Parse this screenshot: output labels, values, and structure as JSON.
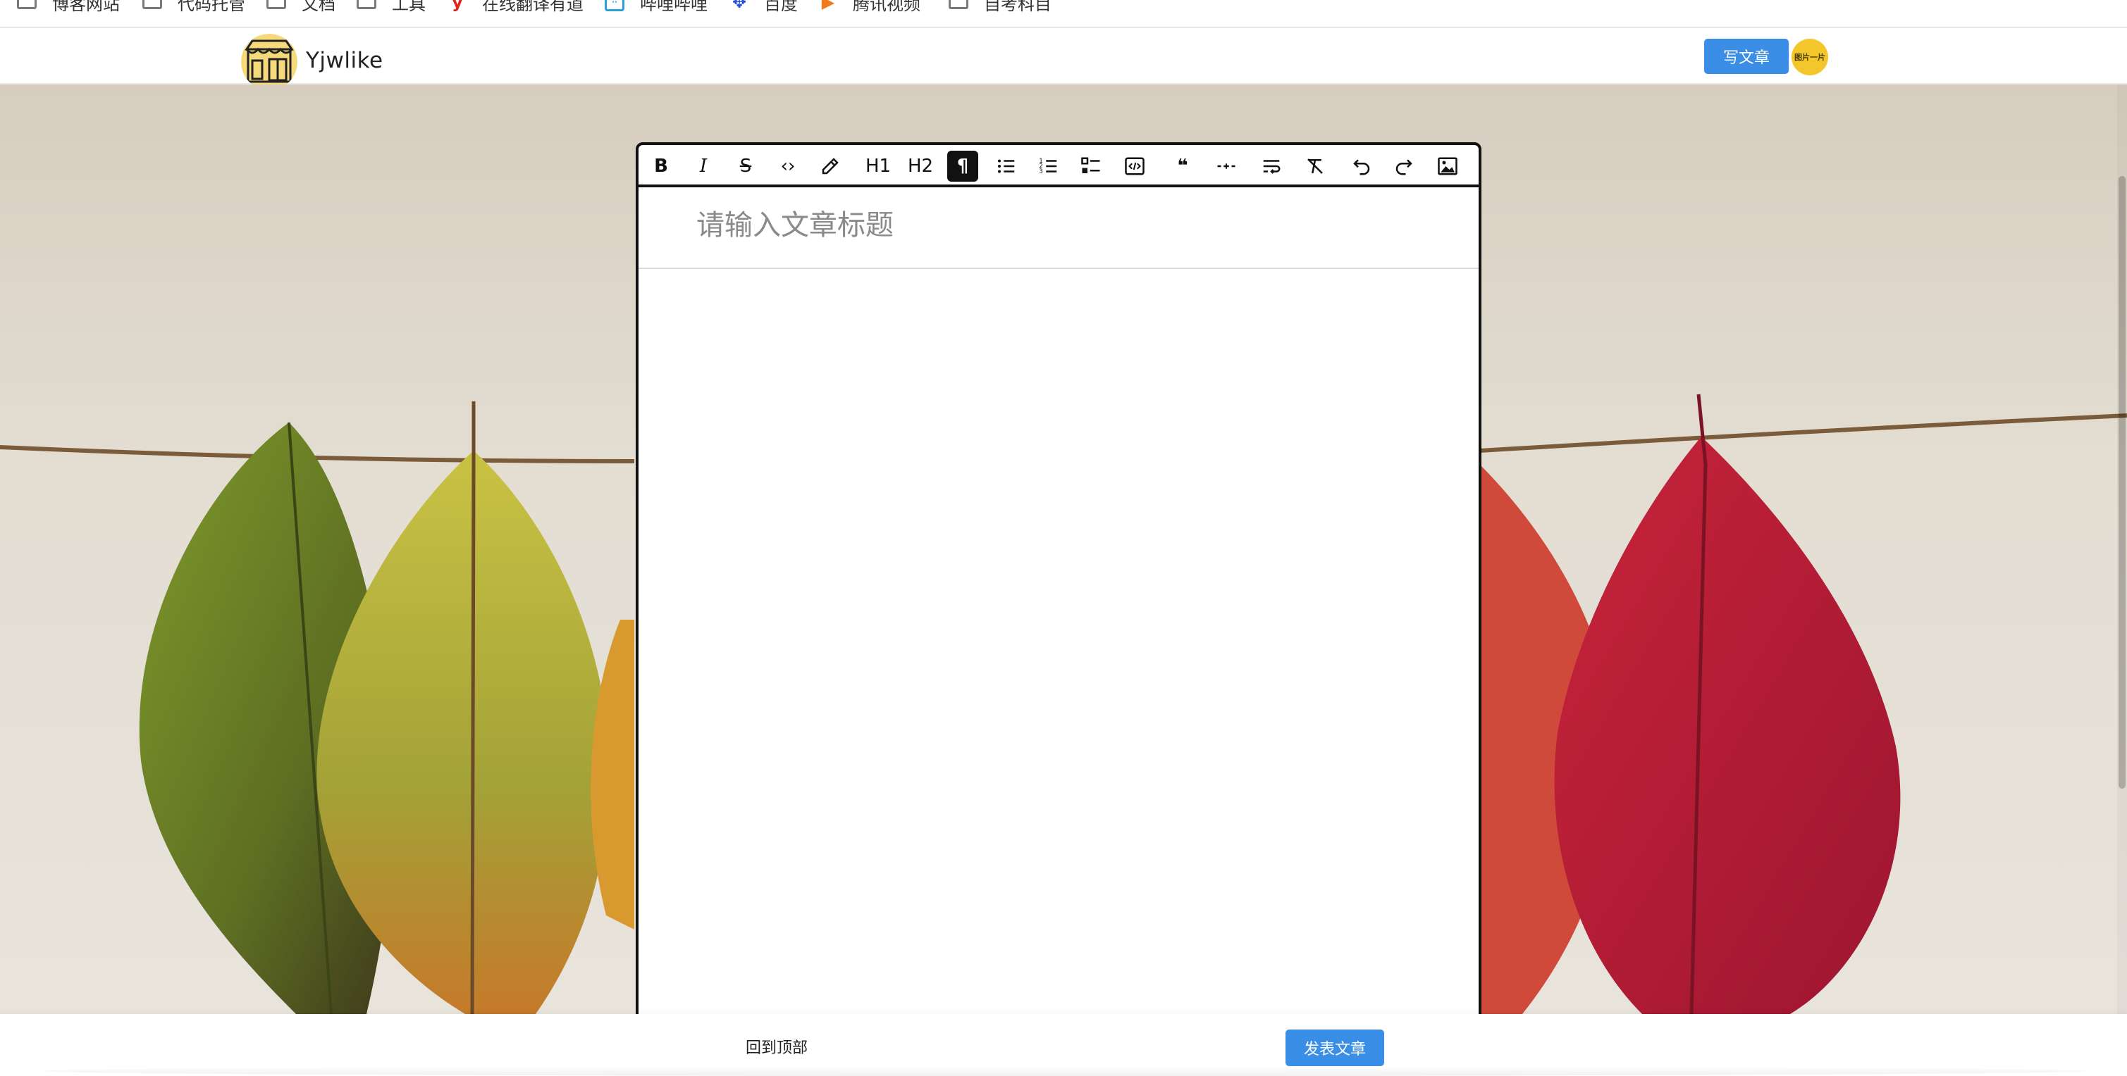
{
  "bookmarks": [
    {
      "label": "博客网站",
      "icon": "folder-icon"
    },
    {
      "label": "代码托管",
      "icon": "folder-icon"
    },
    {
      "label": "文档",
      "icon": "folder-icon"
    },
    {
      "label": "工具",
      "icon": "folder-icon"
    },
    {
      "label": "在线翻译有道",
      "icon": "youdao-icon"
    },
    {
      "label": "哔哩哔哩",
      "icon": "bilibili-icon"
    },
    {
      "label": "百度",
      "icon": "baidu-icon"
    },
    {
      "label": "腾讯视频",
      "icon": "tencent-video-icon"
    },
    {
      "label": "自考科目",
      "icon": "folder-icon"
    }
  ],
  "header": {
    "site_name": "Yjwlike",
    "write_button": "写文章",
    "avatar_text": "图片一片",
    "accent_color": "#3a8ee6"
  },
  "editor": {
    "title_placeholder": "请输入文章标题",
    "title_value": "",
    "toolbar": [
      {
        "name": "bold-button",
        "icon": "bold-icon",
        "text": "B"
      },
      {
        "name": "italic-button",
        "icon": "italic-icon",
        "text": "I"
      },
      {
        "name": "strikethrough-button",
        "icon": "strikethrough-icon",
        "text": "S"
      },
      {
        "name": "inline-code-button",
        "icon": "code-icon",
        "text": "‹›"
      },
      {
        "name": "highlight-button",
        "icon": "highlighter-icon",
        "text": ""
      },
      {
        "name": "heading1-button",
        "icon": "heading1-icon",
        "text": "H1"
      },
      {
        "name": "heading2-button",
        "icon": "heading2-icon",
        "text": "H2"
      },
      {
        "name": "paragraph-button",
        "icon": "paragraph-icon",
        "text": "¶",
        "active": true
      },
      {
        "name": "bullet-list-button",
        "icon": "bullet-list-icon",
        "text": ""
      },
      {
        "name": "ordered-list-button",
        "icon": "ordered-list-icon",
        "text": ""
      },
      {
        "name": "task-list-button",
        "icon": "task-list-icon",
        "text": ""
      },
      {
        "name": "code-block-button",
        "icon": "code-block-icon",
        "text": ""
      },
      {
        "name": "blockquote-button",
        "icon": "quote-icon",
        "text": "❝"
      },
      {
        "name": "horizontal-rule-button",
        "icon": "horizontal-rule-icon",
        "text": ""
      },
      {
        "name": "hard-break-button",
        "icon": "wrap-text-icon",
        "text": ""
      },
      {
        "name": "clear-format-button",
        "icon": "clear-format-icon",
        "text": ""
      },
      {
        "name": "undo-button",
        "icon": "undo-icon",
        "text": ""
      },
      {
        "name": "redo-button",
        "icon": "redo-icon",
        "text": ""
      },
      {
        "name": "insert-image-button",
        "icon": "image-icon",
        "text": ""
      }
    ]
  },
  "footer": {
    "back_to_top": "回到顶部",
    "publish_button": "发表文章"
  }
}
